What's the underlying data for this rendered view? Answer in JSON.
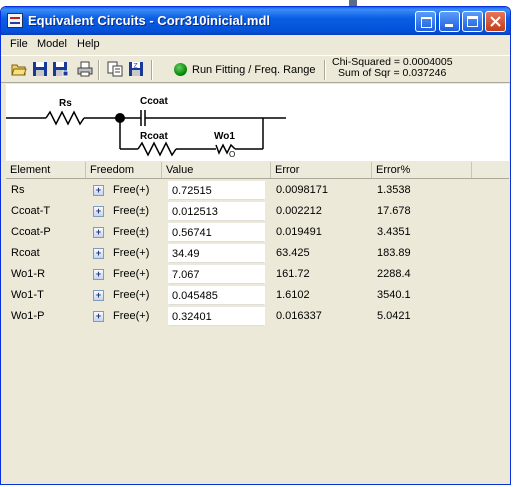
{
  "window": {
    "title": "Equivalent Circuits - Corr310inicial.mdl"
  },
  "menu": {
    "items": [
      "File",
      "Model",
      "Help"
    ]
  },
  "toolbar": {
    "run_label": "Run Fitting / Freq. Range",
    "chi_squared": "Chi-Squared = 0.0004005",
    "sum_of_sqr": "Sum of Sqr = 0.037246"
  },
  "circuit": {
    "labels": {
      "rs": "Rs",
      "ccoat": "Ccoat",
      "rcoat": "Rcoat",
      "wo1": "Wo1",
      "wo_sub": "O"
    }
  },
  "table": {
    "columns": [
      "Element",
      "Freedom",
      "Value",
      "Error",
      "Error%"
    ],
    "rows": [
      {
        "element": "Rs",
        "plus": "+",
        "freedom": "Free(+)",
        "value": "0.72515",
        "error": "0.0098171",
        "error_pct": "1.3538"
      },
      {
        "element": "Ccoat-T",
        "plus": "+",
        "freedom": "Free(±)",
        "value": "0.012513",
        "error": "0.002212",
        "error_pct": "17.678"
      },
      {
        "element": "Ccoat-P",
        "plus": "+",
        "freedom": "Free(±)",
        "value": "0.56741",
        "error": "0.019491",
        "error_pct": "3.4351"
      },
      {
        "element": "Rcoat",
        "plus": "+",
        "freedom": "Free(+)",
        "value": "34.49",
        "error": "63.425",
        "error_pct": "183.89"
      },
      {
        "element": "Wo1-R",
        "plus": "+",
        "freedom": "Free(+)",
        "value": "7.067",
        "error": "161.72",
        "error_pct": "2288.4"
      },
      {
        "element": "Wo1-T",
        "plus": "+",
        "freedom": "Free(+)",
        "value": "0.045485",
        "error": "1.6102",
        "error_pct": "3540.1"
      },
      {
        "element": "Wo1-P",
        "plus": "+",
        "freedom": "Free(+)",
        "value": "0.32401",
        "error": "0.016337",
        "error_pct": "5.0421"
      }
    ]
  }
}
